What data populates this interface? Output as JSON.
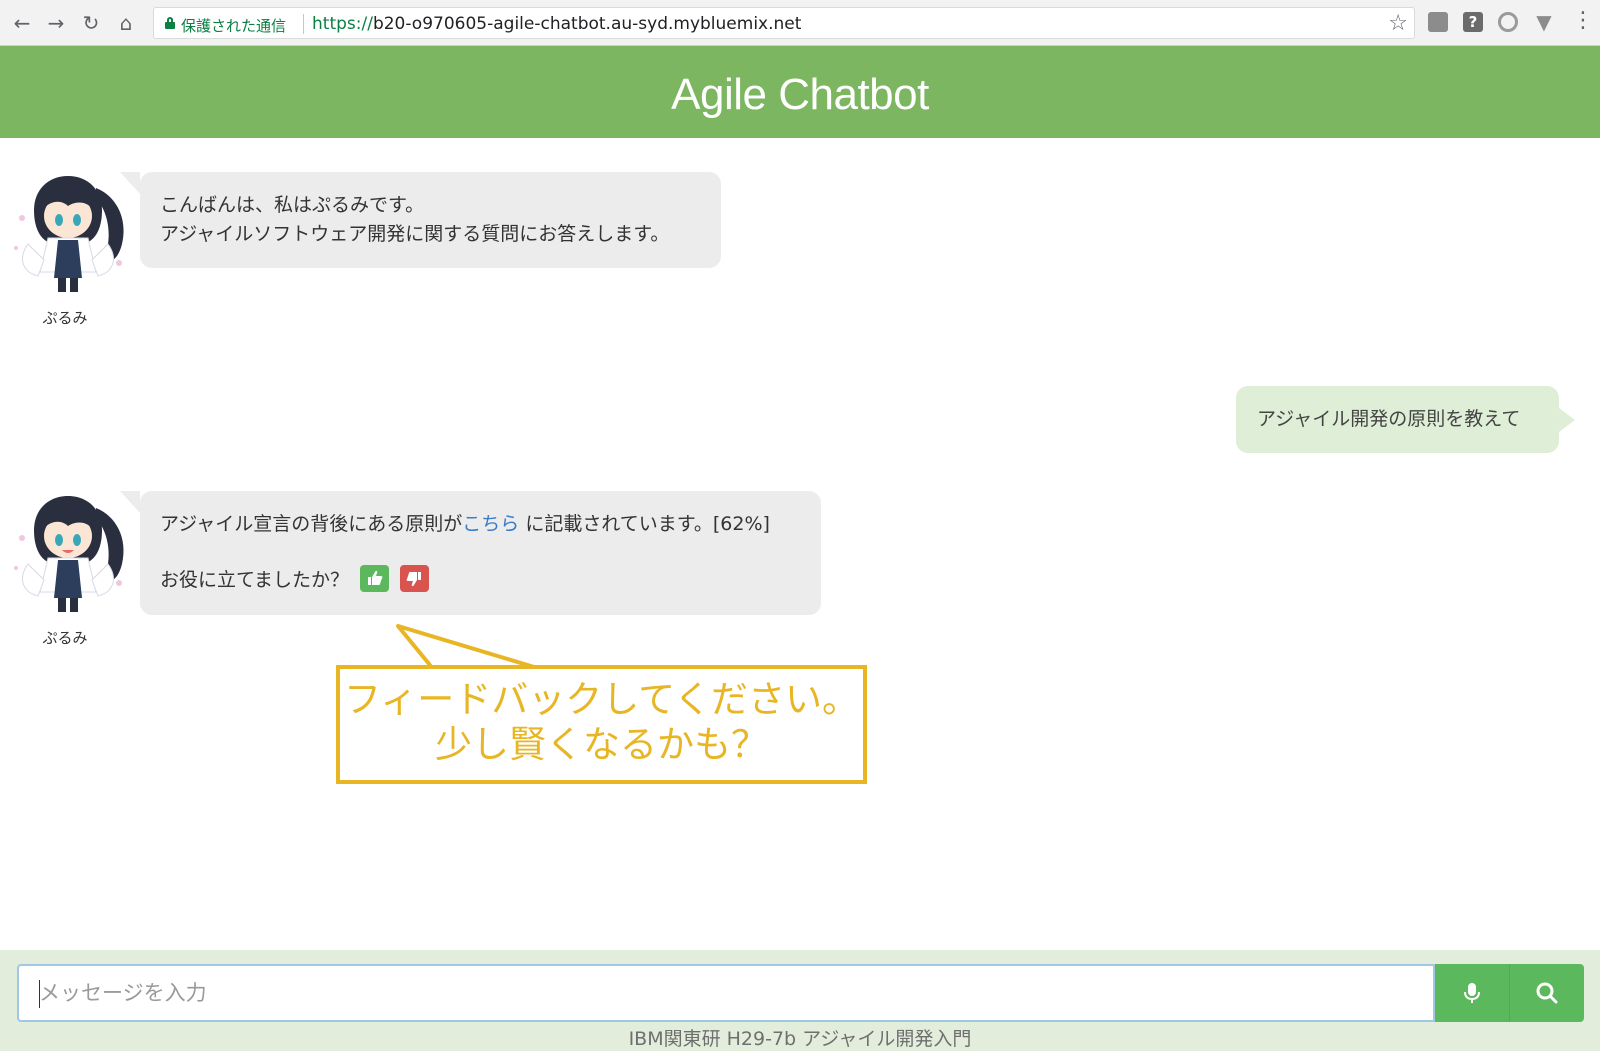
{
  "browser": {
    "secure_label": "保護された通信",
    "url_scheme": "https://",
    "url_rest": "b20-o970605-agile-chatbot.au-syd.mybluemix.net"
  },
  "app": {
    "title": "Agile Chatbot",
    "header_color": "#7db660"
  },
  "messages": [
    {
      "from": "bot",
      "name": "ぷるみ",
      "line1": "こんばんは、私はぷるみです。",
      "line2": "アジャイルソフトウェア開発に関する質問にお答えします。"
    },
    {
      "from": "user",
      "text": "アジャイル開発の原則を教えて"
    },
    {
      "from": "bot",
      "name": "ぷるみ",
      "text_before_link": "アジャイル宣言の背後にある原則が",
      "link_text": "こちら",
      "text_after_link": " に記載されています。[62%]",
      "feedback_question": "お役に立てましたか？"
    }
  ],
  "callout": {
    "line1": "フィードバックしてください。",
    "line2": "少し賢くなるかも？",
    "color": "#e8b624"
  },
  "input": {
    "placeholder": "メッセージを入力"
  },
  "footer": {
    "text": "IBM関東研 H29-7b アジャイル開発入門"
  },
  "icons": {
    "mic": "microphone-icon",
    "search": "search-icon",
    "thumbs_up": "thumbs-up-icon",
    "thumbs_down": "thumbs-down-icon"
  }
}
